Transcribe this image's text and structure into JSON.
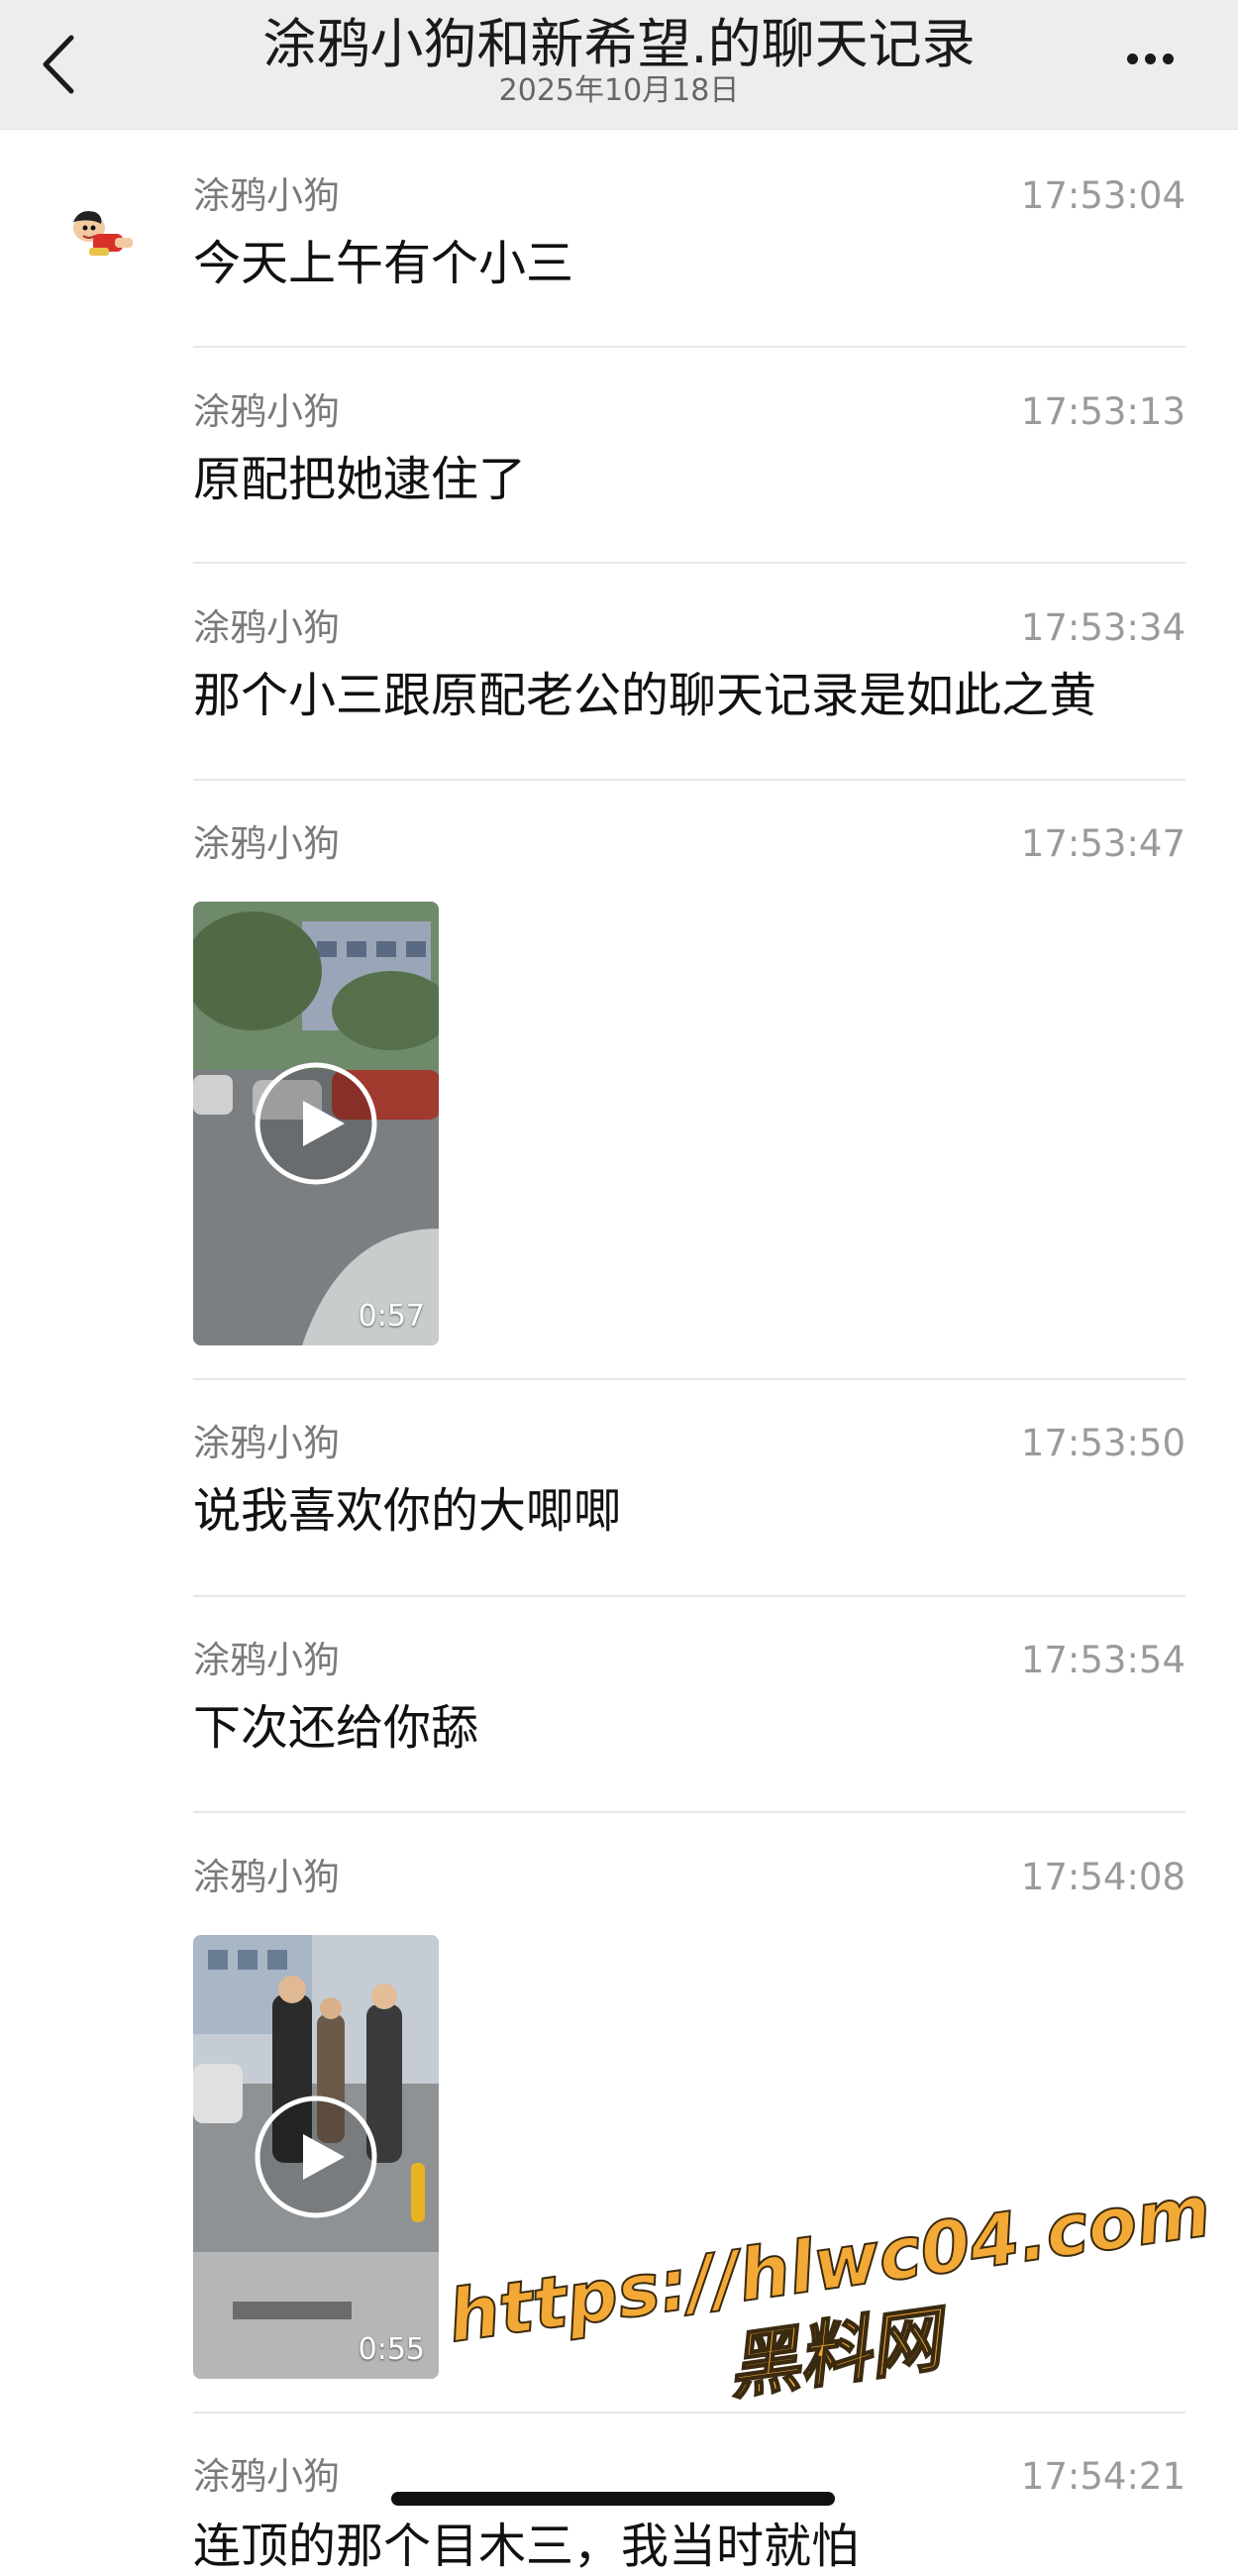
{
  "header": {
    "title": "涂鸦小狗和新希望.的聊天记录",
    "date": "2025年10月18日"
  },
  "messages": [
    {
      "sender": "涂鸦小狗",
      "time": "17:53:04",
      "text": "今天上午有个小三"
    },
    {
      "sender": "涂鸦小狗",
      "time": "17:53:13",
      "text": "原配把她逮住了"
    },
    {
      "sender": "涂鸦小狗",
      "time": "17:53:34",
      "text": "那个小三跟原配老公的聊天记录是如此之黄"
    },
    {
      "sender": "涂鸦小狗",
      "time": "17:53:47",
      "video_duration": "0:57"
    },
    {
      "sender": "涂鸦小狗",
      "time": "17:53:50",
      "text": "说我喜欢你的大唧唧"
    },
    {
      "sender": "涂鸦小狗",
      "time": "17:53:54",
      "text": "下次还给你舔"
    },
    {
      "sender": "涂鸦小狗",
      "time": "17:54:08",
      "video_duration": "0:55"
    },
    {
      "sender": "涂鸦小狗",
      "time": "17:54:21",
      "text": "连顶的那个目木三，我当时就怕"
    }
  ],
  "watermark": {
    "url": "https://hlwc04.com",
    "name": "黑料网"
  },
  "icons": {
    "back": "chevron-left-icon",
    "more": "more-dots-icon",
    "play": "play-icon"
  },
  "colors": {
    "header_bg": "#ededed",
    "watermark": "#f3a935"
  }
}
